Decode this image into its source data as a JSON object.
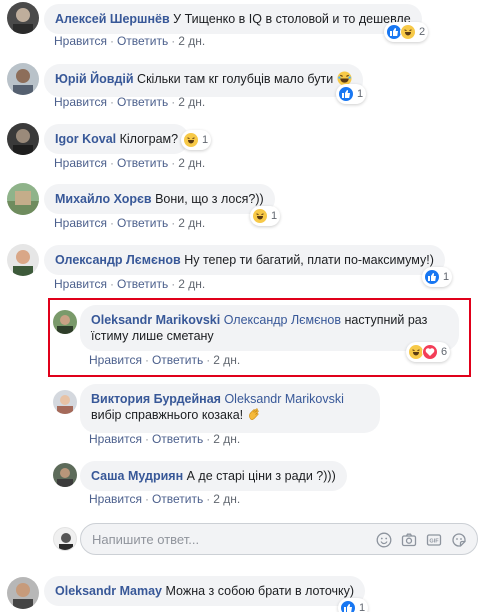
{
  "comments": [
    {
      "author": "Алексей Шершнёв",
      "text": "У Тищенко в IQ в столовой и то дешевле",
      "like": "Нравится",
      "reply": "Ответить",
      "time": "2 дн.",
      "reactions": {
        "count": "2"
      }
    },
    {
      "author": "Юрій Йовдій",
      "text": "Скільки там кг голубців мало бути",
      "like": "Нравится",
      "reply": "Ответить",
      "time": "2 дн.",
      "reactions": {
        "count": "1"
      }
    },
    {
      "author": "Igor Koval",
      "text": "Кілограм?",
      "like": "Нравится",
      "reply": "Ответить",
      "time": "2 дн.",
      "reactions": {
        "count": "1"
      }
    },
    {
      "author": "Михайло Хорєв",
      "text": "Вони, що з лося?))",
      "like": "Нравится",
      "reply": "Ответить",
      "time": "2 дн.",
      "reactions": {
        "count": "1"
      }
    },
    {
      "author": "Олександр Лємєнов",
      "text": "Ну тепер ти багатий, плати по-максимуму!)",
      "like": "Нравится",
      "reply": "Ответить",
      "time": "2 дн.",
      "reactions": {
        "count": "1"
      }
    }
  ],
  "replies": [
    {
      "author": "Oleksandr Marikovski",
      "mention": "Олександр Лємєнов",
      "text": "наступний раз їстиму лише сметану",
      "like": "Нравится",
      "reply": "Ответить",
      "time": "2 дн.",
      "reactions": {
        "count": "6"
      }
    },
    {
      "author": "Виктория Бурдейная",
      "mention": "Oleksandr Marikovski",
      "text": "вибір справжнього козака!",
      "like": "Нравится",
      "reply": "Ответить",
      "time": "2 дн."
    },
    {
      "author": "Саша Мудриян",
      "mention": "",
      "text": "А де старі ціни з ради ?)))",
      "like": "Нравится",
      "reply": "Ответить",
      "time": "2 дн."
    }
  ],
  "reply_box": {
    "placeholder": "Напишите ответ..."
  },
  "last_comment": {
    "author": "Oleksandr Mamay",
    "text": "Можна з собою брати в лоточку)",
    "reactions": {
      "count": "1"
    }
  },
  "colors": {
    "link": "#385898",
    "bubble": "#f2f3f5",
    "highlight": "#e0001a",
    "like_blue": "#1877f2"
  }
}
